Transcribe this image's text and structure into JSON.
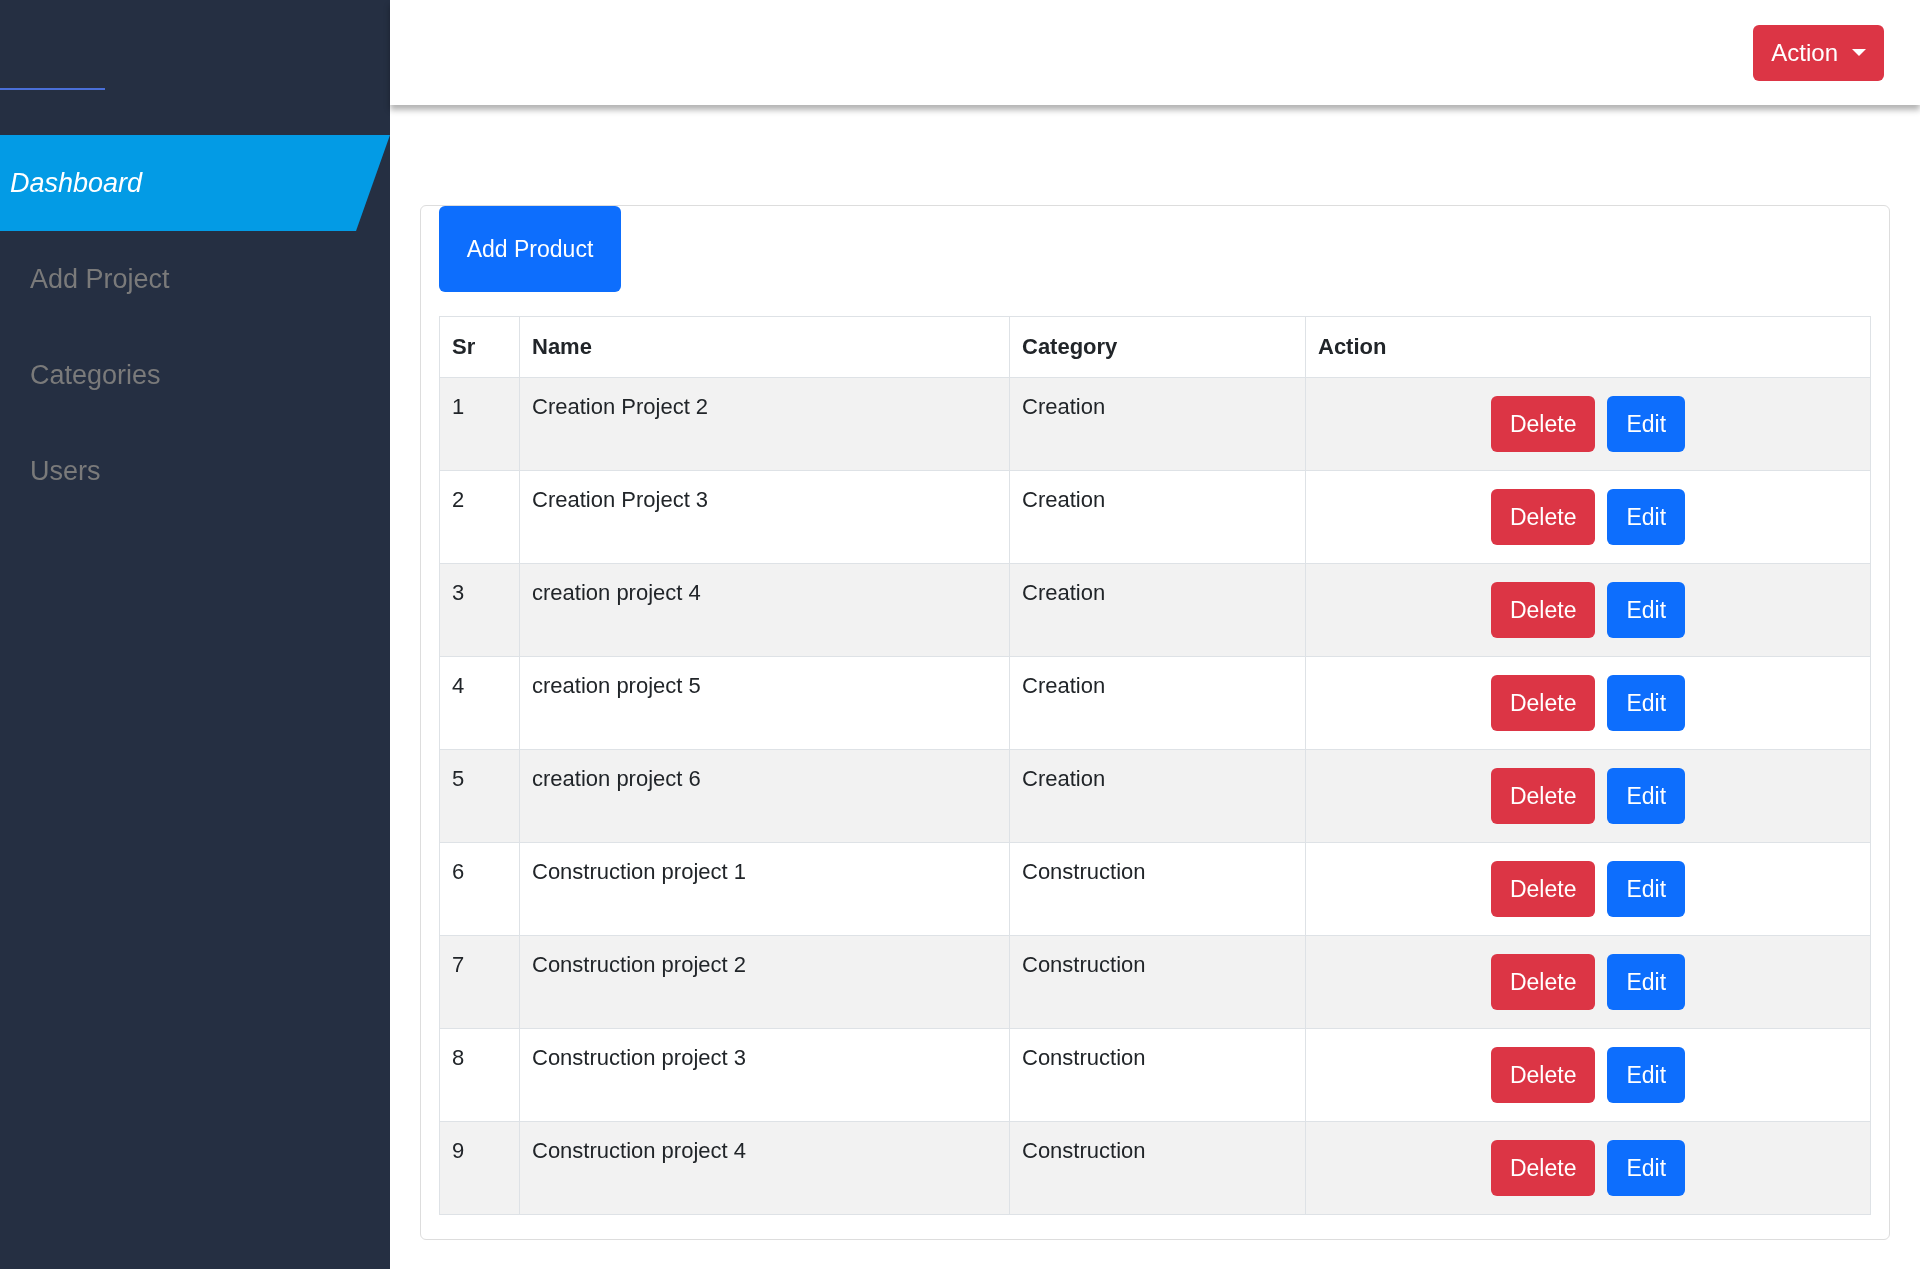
{
  "sidebar": {
    "items": [
      {
        "label": "Dashboard",
        "selected": true
      },
      {
        "label": "Add Project",
        "selected": false
      },
      {
        "label": "Categories",
        "selected": false
      },
      {
        "label": "Users",
        "selected": false
      }
    ]
  },
  "topbar": {
    "action_button": "Action"
  },
  "add_button": "Add Product",
  "table": {
    "columns": [
      "Sr",
      "Name",
      "Category",
      "Action"
    ],
    "rows": [
      {
        "sr": "1",
        "name": "Creation Project 2",
        "category": "Creation",
        "buttons": [
          "Delete",
          "Edit"
        ]
      },
      {
        "sr": "2",
        "name": "Creation Project 3",
        "category": "Creation",
        "buttons": [
          "Delete",
          "Edit"
        ]
      },
      {
        "sr": "3",
        "name": "creation project 4",
        "category": "Creation",
        "buttons": [
          "Delete",
          "Edit"
        ]
      },
      {
        "sr": "4",
        "name": "creation project 5",
        "category": "Creation",
        "buttons": [
          "Delete",
          "Edit"
        ]
      },
      {
        "sr": "5",
        "name": "creation project 6",
        "category": "Creation",
        "buttons": [
          "Delete",
          "Edit"
        ]
      },
      {
        "sr": "6",
        "name": "Construction project 1",
        "category": "Construction",
        "buttons": [
          "Delete",
          "Edit"
        ]
      },
      {
        "sr": "7",
        "name": "Construction project 2",
        "category": "Construction",
        "buttons": [
          "Delete",
          "Edit"
        ]
      },
      {
        "sr": "8",
        "name": "Construction project 3",
        "category": "Construction",
        "buttons": [
          "Delete",
          "Edit"
        ]
      },
      {
        "sr": "9",
        "name": "Construction project 4",
        "category": "Construction",
        "buttons": [
          "Delete",
          "Edit"
        ]
      }
    ]
  }
}
